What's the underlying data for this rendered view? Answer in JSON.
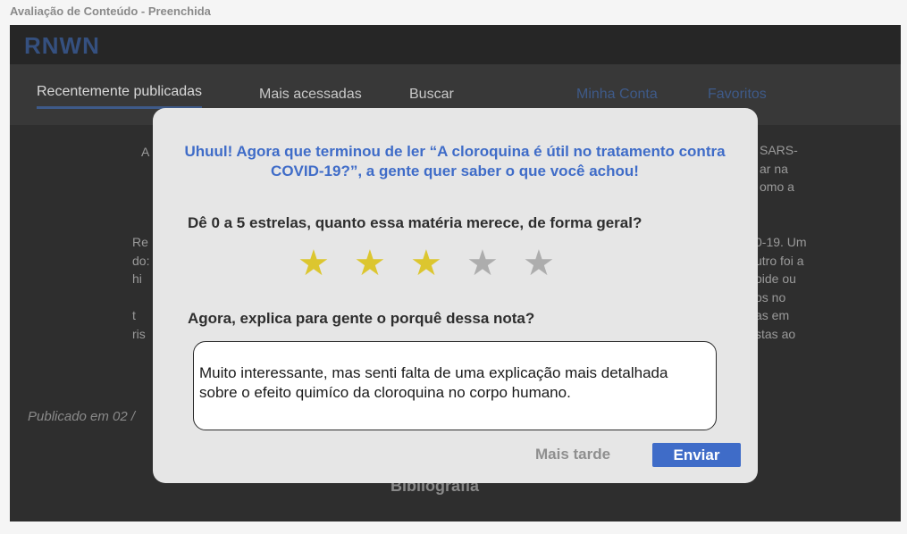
{
  "frame_label": "Avaliação de Conteúdo - Preenchida",
  "app": {
    "logo": "RNWN",
    "nav": {
      "recent": "Recentemente publicadas",
      "most_accessed": "Mais acessadas",
      "search": "Buscar",
      "account": "Minha Conta",
      "favorites": "Favoritos"
    },
    "background": {
      "left_a": "A",
      "left_block": "Re\ndo:\nhi\n\nt\nris",
      "right_block_1": "SARS-\nar na\nomo a",
      "right_block_2": "0-19. Um\nutro foi a\noide ou\nos no\nas em\nstas ao",
      "published": "Publicado em 02 /",
      "bibliography": "Bibliografia"
    }
  },
  "modal": {
    "title": "Uhuul! Agora que terminou de ler “A cloroquina é útil no tratamento contra COVID-19?”, a gente quer saber o que você achou!",
    "rating_question": "Dê 0 a 5 estrelas, quanto essa matéria merece, de forma geral?",
    "rating": {
      "value": 3,
      "max": 5,
      "filled_color": "#dcc62f",
      "empty_color": "#adadad"
    },
    "reason_question": "Agora, explica para gente o porquê dessa nota?",
    "reason_text": "Muito interessante, mas senti falta de uma explicação mais detalhada sobre o efeito quimíco da cloroquina no corpo humano.",
    "later_button": "Mais tarde",
    "send_button": "Enviar",
    "accent_color": "#3f6cc8"
  }
}
